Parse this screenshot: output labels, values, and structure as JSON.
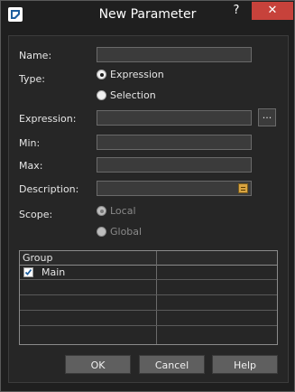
{
  "window": {
    "title": "New Parameter",
    "help_glyph": "?",
    "close_glyph": "✕"
  },
  "form": {
    "name_label": "Name:",
    "type_label": "Type:",
    "type_options": [
      "Expression",
      "Selection"
    ],
    "type_selected": "Expression",
    "expression_label": "Expression:",
    "expression_browse": "...",
    "min_label": "Min:",
    "max_label": "Max:",
    "description_label": "Description:",
    "scope_label": "Scope:",
    "scope_options": [
      "Local",
      "Global"
    ],
    "scope_selected": "Local",
    "name_value": "",
    "expression_value": "",
    "min_value": "",
    "max_value": "",
    "description_value": ""
  },
  "group_table": {
    "columns": [
      "Group",
      ""
    ],
    "rows": [
      {
        "checked": true,
        "label": "Main"
      },
      {
        "checked": false,
        "label": ""
      },
      {
        "checked": false,
        "label": ""
      },
      {
        "checked": false,
        "label": ""
      },
      {
        "checked": false,
        "label": ""
      }
    ]
  },
  "buttons": {
    "ok": "OK",
    "cancel": "Cancel",
    "help": "Help"
  },
  "icons": {
    "app": "app-icon",
    "description_editor": "notepad-icon"
  }
}
